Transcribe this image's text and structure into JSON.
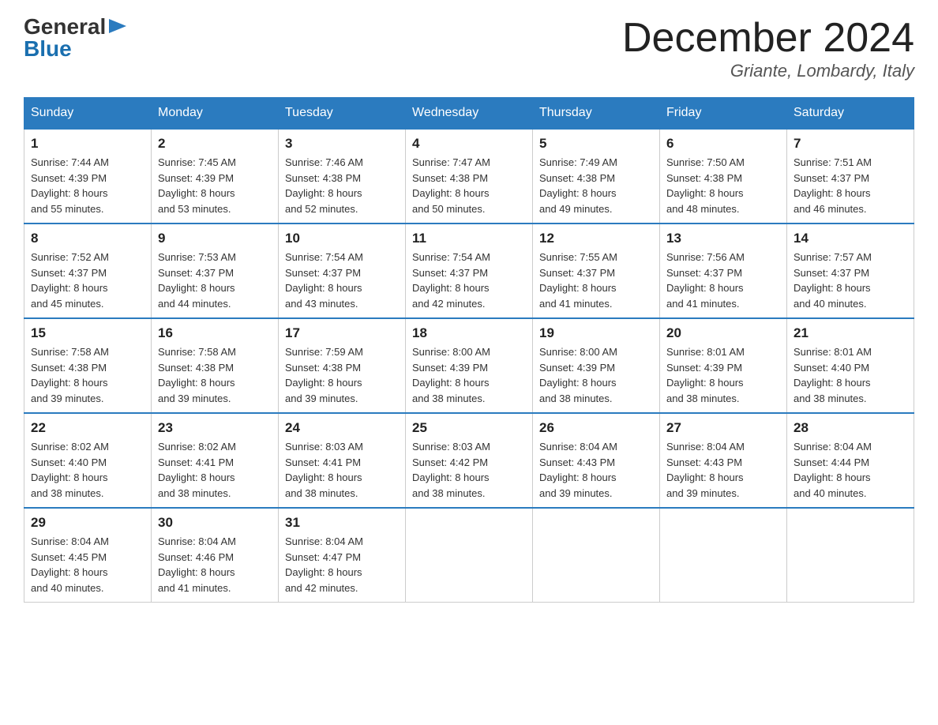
{
  "header": {
    "logo_general": "General",
    "logo_blue": "Blue",
    "month_title": "December 2024",
    "location": "Griante, Lombardy, Italy"
  },
  "days_of_week": [
    "Sunday",
    "Monday",
    "Tuesday",
    "Wednesday",
    "Thursday",
    "Friday",
    "Saturday"
  ],
  "weeks": [
    [
      {
        "num": "1",
        "sunrise": "7:44 AM",
        "sunset": "4:39 PM",
        "daylight": "8 hours and 55 minutes."
      },
      {
        "num": "2",
        "sunrise": "7:45 AM",
        "sunset": "4:39 PM",
        "daylight": "8 hours and 53 minutes."
      },
      {
        "num": "3",
        "sunrise": "7:46 AM",
        "sunset": "4:38 PM",
        "daylight": "8 hours and 52 minutes."
      },
      {
        "num": "4",
        "sunrise": "7:47 AM",
        "sunset": "4:38 PM",
        "daylight": "8 hours and 50 minutes."
      },
      {
        "num": "5",
        "sunrise": "7:49 AM",
        "sunset": "4:38 PM",
        "daylight": "8 hours and 49 minutes."
      },
      {
        "num": "6",
        "sunrise": "7:50 AM",
        "sunset": "4:38 PM",
        "daylight": "8 hours and 48 minutes."
      },
      {
        "num": "7",
        "sunrise": "7:51 AM",
        "sunset": "4:37 PM",
        "daylight": "8 hours and 46 minutes."
      }
    ],
    [
      {
        "num": "8",
        "sunrise": "7:52 AM",
        "sunset": "4:37 PM",
        "daylight": "8 hours and 45 minutes."
      },
      {
        "num": "9",
        "sunrise": "7:53 AM",
        "sunset": "4:37 PM",
        "daylight": "8 hours and 44 minutes."
      },
      {
        "num": "10",
        "sunrise": "7:54 AM",
        "sunset": "4:37 PM",
        "daylight": "8 hours and 43 minutes."
      },
      {
        "num": "11",
        "sunrise": "7:54 AM",
        "sunset": "4:37 PM",
        "daylight": "8 hours and 42 minutes."
      },
      {
        "num": "12",
        "sunrise": "7:55 AM",
        "sunset": "4:37 PM",
        "daylight": "8 hours and 41 minutes."
      },
      {
        "num": "13",
        "sunrise": "7:56 AM",
        "sunset": "4:37 PM",
        "daylight": "8 hours and 41 minutes."
      },
      {
        "num": "14",
        "sunrise": "7:57 AM",
        "sunset": "4:37 PM",
        "daylight": "8 hours and 40 minutes."
      }
    ],
    [
      {
        "num": "15",
        "sunrise": "7:58 AM",
        "sunset": "4:38 PM",
        "daylight": "8 hours and 39 minutes."
      },
      {
        "num": "16",
        "sunrise": "7:58 AM",
        "sunset": "4:38 PM",
        "daylight": "8 hours and 39 minutes."
      },
      {
        "num": "17",
        "sunrise": "7:59 AM",
        "sunset": "4:38 PM",
        "daylight": "8 hours and 39 minutes."
      },
      {
        "num": "18",
        "sunrise": "8:00 AM",
        "sunset": "4:39 PM",
        "daylight": "8 hours and 38 minutes."
      },
      {
        "num": "19",
        "sunrise": "8:00 AM",
        "sunset": "4:39 PM",
        "daylight": "8 hours and 38 minutes."
      },
      {
        "num": "20",
        "sunrise": "8:01 AM",
        "sunset": "4:39 PM",
        "daylight": "8 hours and 38 minutes."
      },
      {
        "num": "21",
        "sunrise": "8:01 AM",
        "sunset": "4:40 PM",
        "daylight": "8 hours and 38 minutes."
      }
    ],
    [
      {
        "num": "22",
        "sunrise": "8:02 AM",
        "sunset": "4:40 PM",
        "daylight": "8 hours and 38 minutes."
      },
      {
        "num": "23",
        "sunrise": "8:02 AM",
        "sunset": "4:41 PM",
        "daylight": "8 hours and 38 minutes."
      },
      {
        "num": "24",
        "sunrise": "8:03 AM",
        "sunset": "4:41 PM",
        "daylight": "8 hours and 38 minutes."
      },
      {
        "num": "25",
        "sunrise": "8:03 AM",
        "sunset": "4:42 PM",
        "daylight": "8 hours and 38 minutes."
      },
      {
        "num": "26",
        "sunrise": "8:04 AM",
        "sunset": "4:43 PM",
        "daylight": "8 hours and 39 minutes."
      },
      {
        "num": "27",
        "sunrise": "8:04 AM",
        "sunset": "4:43 PM",
        "daylight": "8 hours and 39 minutes."
      },
      {
        "num": "28",
        "sunrise": "8:04 AM",
        "sunset": "4:44 PM",
        "daylight": "8 hours and 40 minutes."
      }
    ],
    [
      {
        "num": "29",
        "sunrise": "8:04 AM",
        "sunset": "4:45 PM",
        "daylight": "8 hours and 40 minutes."
      },
      {
        "num": "30",
        "sunrise": "8:04 AM",
        "sunset": "4:46 PM",
        "daylight": "8 hours and 41 minutes."
      },
      {
        "num": "31",
        "sunrise": "8:04 AM",
        "sunset": "4:47 PM",
        "daylight": "8 hours and 42 minutes."
      },
      null,
      null,
      null,
      null
    ]
  ],
  "labels": {
    "sunrise": "Sunrise:",
    "sunset": "Sunset:",
    "daylight": "Daylight:"
  }
}
